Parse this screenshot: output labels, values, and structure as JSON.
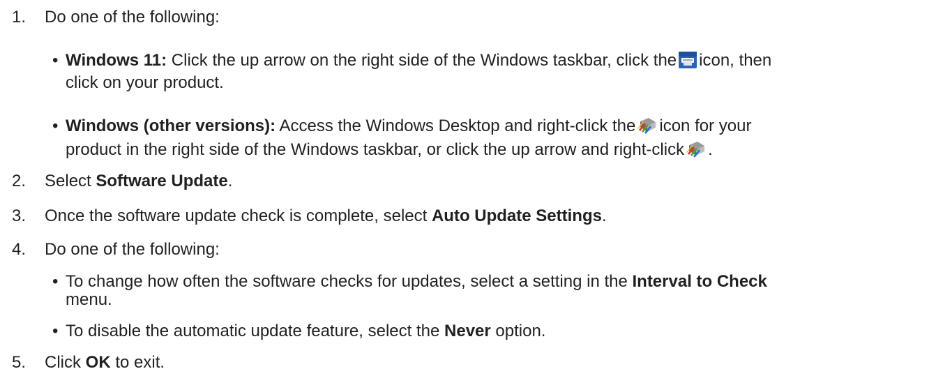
{
  "steps": [
    {
      "num": "1.",
      "text": "Do one of the following:"
    },
    {
      "num": "2.",
      "pre": "Select ",
      "bold": "Software Update",
      "post": "."
    },
    {
      "num": "3.",
      "pre": "Once the software update check is complete, select ",
      "bold": "Auto Update Settings",
      "post": "."
    },
    {
      "num": "4.",
      "text": "Do one of the following:"
    },
    {
      "num": "5.",
      "pre": "Click ",
      "bold": "OK",
      "post": " to exit."
    }
  ],
  "step1_bullets": [
    {
      "bold": "Windows 11:",
      "pre": " Click the up arrow on the right side of the Windows taskbar, click the",
      "post": "icon, then",
      "line2": "click on your product."
    },
    {
      "bold": "Windows (other versions):",
      "pre": " Access the Windows Desktop and right-click the",
      "post": "icon for your",
      "line2_pre": "product in the right side of the Windows taskbar, or click the up arrow and right-click",
      "line2_post": "."
    }
  ],
  "step4_bullets": [
    {
      "pre": "To change how often the software checks for updates, select a setting in the ",
      "bold": "Interval to Check",
      "line2": "menu."
    },
    {
      "pre": "To disable the automatic update feature, select the ",
      "bold": "Never",
      "post": " option."
    }
  ],
  "bullet_char": "•",
  "icons": [
    "printer-tray-icon",
    "epson-software-updater-icon",
    "epson-software-updater-icon"
  ]
}
